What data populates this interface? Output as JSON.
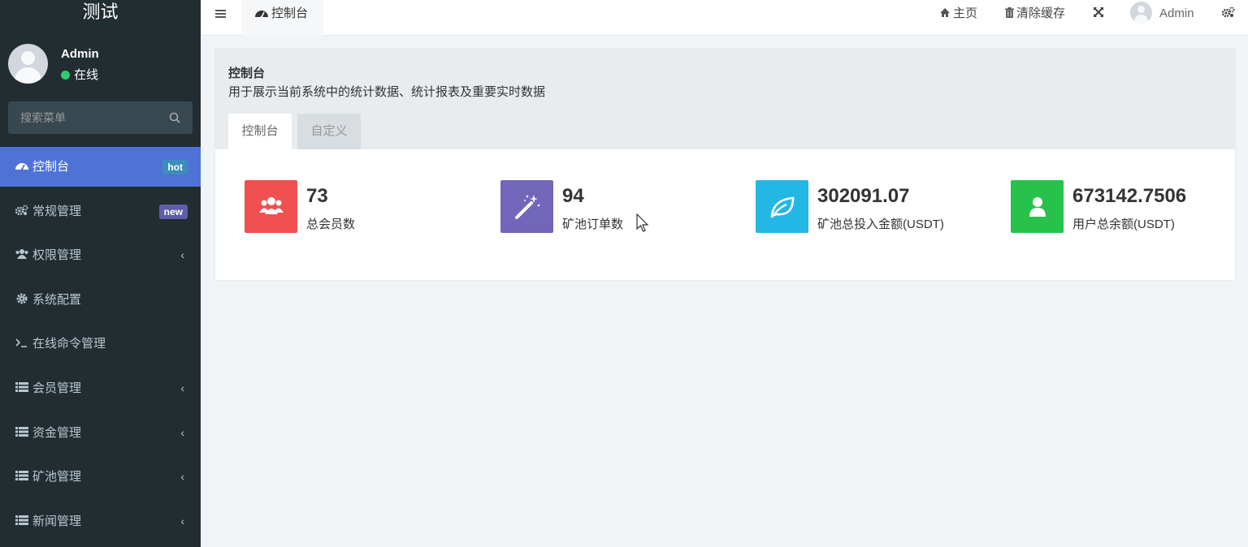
{
  "brand": "测试",
  "user": {
    "name": "Admin",
    "status": "在线"
  },
  "search": {
    "placeholder": "搜索菜单"
  },
  "menu": [
    {
      "label": "控制台",
      "icon": "dashboard-icon",
      "badge": "hot",
      "badge_color": "#3c8dbc",
      "active": true
    },
    {
      "label": "常规管理",
      "icon": "cogs-icon",
      "badge": "new",
      "badge_color": "#605ca8"
    },
    {
      "label": "权限管理",
      "icon": "users-icon",
      "caret": "‹"
    },
    {
      "label": "系统配置",
      "icon": "gear-icon"
    },
    {
      "label": "在线命令管理",
      "icon": "terminal-icon"
    },
    {
      "label": "会员管理",
      "icon": "list-icon",
      "caret": "‹"
    },
    {
      "label": "资金管理",
      "icon": "list-icon",
      "caret": "‹"
    },
    {
      "label": "矿池管理",
      "icon": "list-icon",
      "caret": "‹"
    },
    {
      "label": "新闻管理",
      "icon": "list-icon",
      "caret": "‹"
    }
  ],
  "topbar": {
    "tab_label": "控制台",
    "home": "主页",
    "clear_cache": "清除缓存",
    "admin": "Admin"
  },
  "panel": {
    "title": "控制台",
    "description": "用于展示当前系统中的统计数据、统计报表及重要实时数据",
    "tabs": [
      "控制台",
      "自定义"
    ]
  },
  "stats": [
    {
      "value": "73",
      "label": "总会员数",
      "color": "#f05050",
      "icon": "users-icon"
    },
    {
      "value": "94",
      "label": "矿池订单数",
      "color": "#7266ba",
      "icon": "magic-wand-icon"
    },
    {
      "value": "302091.07",
      "label": "矿池总投入金额(USDT)",
      "color": "#23b7e5",
      "icon": "leaf-icon"
    },
    {
      "value": "673142.7506",
      "label": "用户总余额(USDT)",
      "color": "#27c24c",
      "icon": "user-icon"
    }
  ]
}
